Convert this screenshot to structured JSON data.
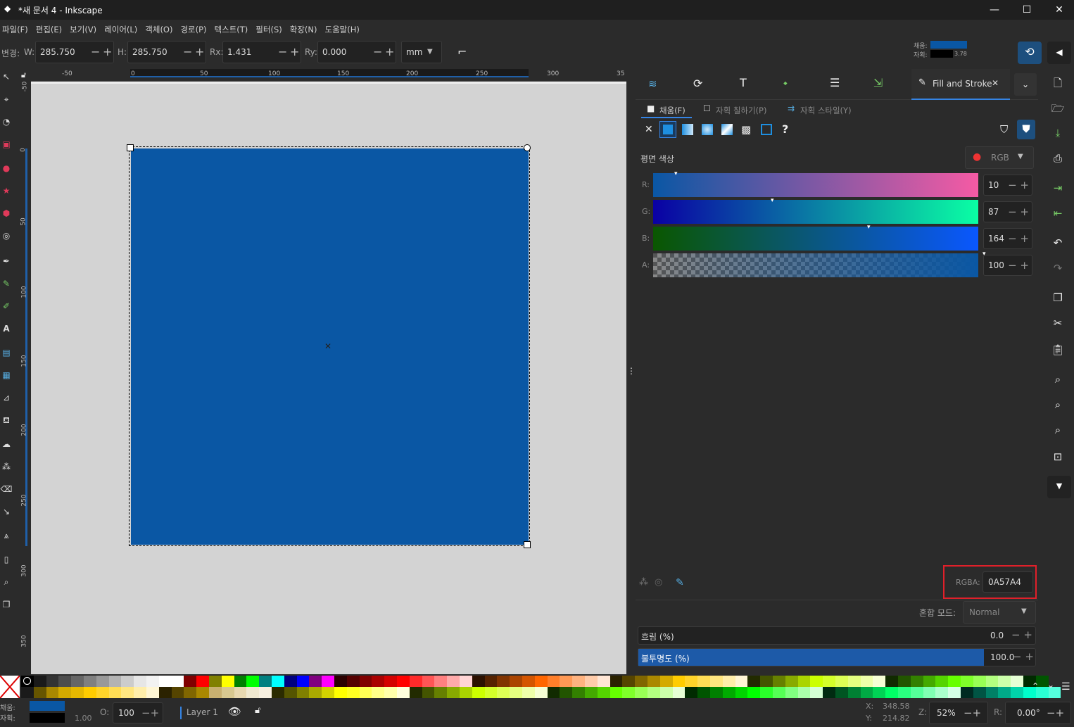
{
  "window": {
    "title": "*새 문서 4 - Inkscape",
    "minimize": "—",
    "maximize": "☐",
    "close": "✕"
  },
  "menu": [
    "파일(F)",
    "편집(E)",
    "보기(V)",
    "레이어(L)",
    "객체(O)",
    "경로(P)",
    "텍스트(T)",
    "필터(S)",
    "확장(N)",
    "도움말(H)"
  ],
  "toolctl": {
    "change_label": "변경:",
    "w_label": "W:",
    "w_value": "285.750",
    "h_label": "H:",
    "h_value": "285.750",
    "rx_label": "Rx:",
    "rx_value": "1.431",
    "ry_label": "Ry:",
    "ry_value": "0.000",
    "unit": "mm",
    "fill_label": "채움:",
    "stroke_label": "자획:",
    "stroke_width": "3.78"
  },
  "ruler_h": [
    "-50",
    "0",
    "50",
    "100",
    "150",
    "200",
    "250",
    "300",
    "35"
  ],
  "ruler_v": [
    "-50",
    "0",
    "50",
    "100",
    "150",
    "200",
    "250",
    "300",
    "350"
  ],
  "canvas": {
    "rect_color": "#0A57A4",
    "page_color": "#d3d3d3"
  },
  "dock": {
    "active_tab": "Fill and Stroke",
    "close": "✕"
  },
  "fillstroke": {
    "tabs": [
      "채움(F)",
      "자획 칠하기(P)",
      "자획 스타일(Y)"
    ],
    "flat_color_label": "평면 색상",
    "color_mode": "RGB",
    "channels": [
      {
        "label": "R:",
        "value": "10",
        "level": 0.04
      },
      {
        "label": "G:",
        "value": "87",
        "level": 0.34
      },
      {
        "label": "B:",
        "value": "164",
        "level": 0.64
      },
      {
        "label": "A:",
        "value": "100",
        "level": 1.0
      }
    ],
    "rgba_label": "RGBA:",
    "rgba_value": "0A57A4",
    "blend_label": "혼합 모드:",
    "blend_value": "Normal",
    "blur_label": "흐림 (%)",
    "blur_value": "0.0",
    "opacity_label": "불투명도 (%)",
    "opacity_value": "100.0"
  },
  "status": {
    "fill_label": "채움:",
    "stroke_label": "자획:",
    "stroke_width": "1.00",
    "opacity_label": "O:",
    "opacity_value": "100",
    "layer": "Layer 1",
    "x_label": "X:",
    "x_value": "348.58",
    "y_label": "Y:",
    "y_value": "214.82",
    "zoom_label": "Z:",
    "zoom_value": "52%",
    "rot_label": "R:",
    "rot_value": "0.00°"
  },
  "colors": {
    "accent": "#0A57A4",
    "highlight_red": "#e0202a"
  }
}
